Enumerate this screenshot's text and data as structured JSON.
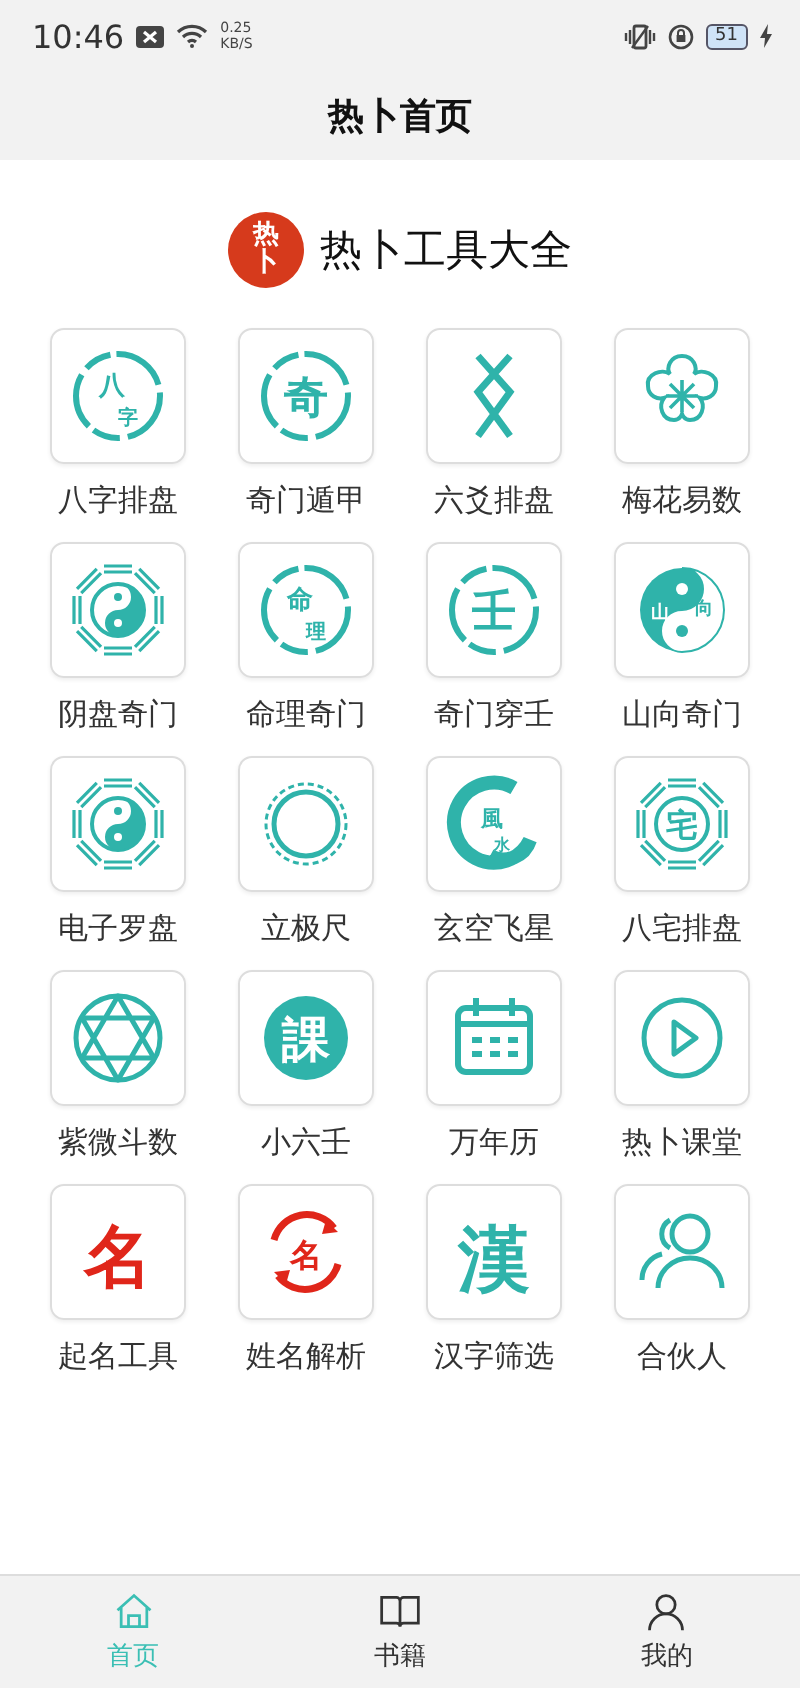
{
  "status_bar": {
    "time": "10:46",
    "speed_value": "0.25",
    "speed_unit": "KB/S",
    "battery": "51"
  },
  "header": {
    "title": "热卜首页"
  },
  "brand": {
    "logo_text": "热卜",
    "title": "热卜工具大全"
  },
  "tools": [
    {
      "label": "八字排盘",
      "kind": "seal",
      "glyph": "八字"
    },
    {
      "label": "奇门遁甲",
      "kind": "seal",
      "glyph": "奇"
    },
    {
      "label": "六爻排盘",
      "kind": "crossing"
    },
    {
      "label": "梅花易数",
      "kind": "plum"
    },
    {
      "label": "阴盘奇门",
      "kind": "taiji-bagua"
    },
    {
      "label": "命理奇门",
      "kind": "seal",
      "glyph": "命理"
    },
    {
      "label": "奇门穿壬",
      "kind": "seal",
      "glyph": "壬"
    },
    {
      "label": "山向奇门",
      "kind": "taiji",
      "glyph": "山向"
    },
    {
      "label": "电子罗盘",
      "kind": "taiji-bagua"
    },
    {
      "label": "立极尺",
      "kind": "ring"
    },
    {
      "label": "玄空飞星",
      "kind": "swirl",
      "glyph": "風水"
    },
    {
      "label": "八宅排盘",
      "kind": "bagua-seal",
      "glyph": "宅"
    },
    {
      "label": "紫微斗数",
      "kind": "star"
    },
    {
      "label": "小六壬",
      "kind": "disc",
      "glyph": "課"
    },
    {
      "label": "万年历",
      "kind": "calendar"
    },
    {
      "label": "热卜课堂",
      "kind": "play"
    },
    {
      "label": "起名工具",
      "kind": "red-glyph",
      "glyph": "名"
    },
    {
      "label": "姓名解析",
      "kind": "cycle",
      "glyph": "名"
    },
    {
      "label": "汉字筛选",
      "kind": "big-glyph",
      "glyph": "漢"
    },
    {
      "label": "合伙人",
      "kind": "people"
    }
  ],
  "tab_bar": [
    {
      "label": "首页",
      "kind": "home",
      "selected": true
    },
    {
      "label": "书籍",
      "kind": "book",
      "selected": false
    },
    {
      "label": "我的",
      "kind": "user",
      "selected": false
    }
  ]
}
